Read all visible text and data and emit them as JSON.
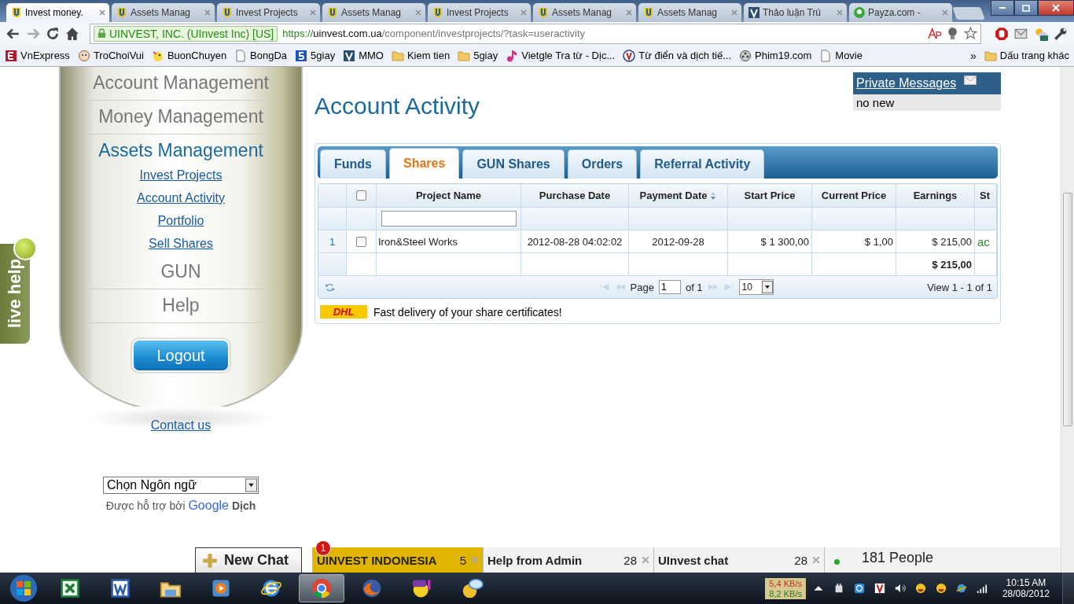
{
  "browser": {
    "tabs": [
      {
        "kind": "shield",
        "title": "Invest money.",
        "selected": true
      },
      {
        "kind": "shield",
        "title": "Assets Manag",
        "selected": false
      },
      {
        "kind": "shield",
        "title": "Invest Projects",
        "selected": false
      },
      {
        "kind": "shield",
        "title": "Assets Manag",
        "selected": false
      },
      {
        "kind": "shield",
        "title": "Invest Projects",
        "selected": false
      },
      {
        "kind": "shield",
        "title": "Assets Manag",
        "selected": false
      },
      {
        "kind": "shield",
        "title": "Assets Manag",
        "selected": false
      },
      {
        "kind": "vsquare",
        "title": "Thảo luận Trú",
        "selected": false
      },
      {
        "kind": "payza",
        "title": "Payza.com -",
        "selected": false
      }
    ],
    "address": {
      "identity": "UINVEST, INC. (UInvest Inc) [US]",
      "scheme": "https://",
      "host": "uinvest.com.ua",
      "path": "/component/investprojects/?task=useractivity"
    },
    "bookmarks": [
      {
        "kind": "ered",
        "label": "VnExpress"
      },
      {
        "kind": "face",
        "label": "TroChoiVui"
      },
      {
        "kind": "chick",
        "label": "BuonChuyen"
      },
      {
        "kind": "page",
        "label": "BongDa"
      },
      {
        "kind": "five",
        "label": "5giay"
      },
      {
        "kind": "vsquare",
        "label": "MMO"
      },
      {
        "kind": "folder",
        "label": "Kiem tien"
      },
      {
        "kind": "folder",
        "label": "5giay"
      },
      {
        "kind": "note",
        "label": "Vietgle Tra từ - Dịc..."
      },
      {
        "kind": "vcircle",
        "label": "Từ điển và dịch tiế..."
      },
      {
        "kind": "reel",
        "label": "Phim19.com"
      },
      {
        "kind": "page",
        "label": "Movie"
      }
    ],
    "overflow": "»",
    "other_bookmarks": "Dấu trang khác"
  },
  "sidebar": {
    "menu": [
      {
        "label": "Account Management",
        "selected": false
      },
      {
        "label": "Money Management",
        "selected": false
      },
      {
        "label": "Assets Management",
        "selected": true,
        "children": [
          {
            "label": "Invest Projects"
          },
          {
            "label": "Account Activity"
          },
          {
            "label": "Portfolio"
          },
          {
            "label": "Sell Shares"
          }
        ]
      },
      {
        "label": "GUN",
        "selected": false
      },
      {
        "label": "Help",
        "selected": false
      }
    ],
    "logout": "Logout",
    "contact": "Contact us",
    "language": {
      "value": "Chọn Ngôn ngữ"
    },
    "powered_by": {
      "text": "Được hỗ trợ bởi",
      "brand": "Google",
      "service": "Dịch"
    }
  },
  "live_help": "live help",
  "heading": "Account Activity",
  "messages": {
    "title": "Private Messages",
    "status": "no new"
  },
  "tabs": [
    {
      "label": "Funds",
      "selected": false
    },
    {
      "label": "Shares",
      "selected": true
    },
    {
      "label": "GUN Shares",
      "selected": false
    },
    {
      "label": "Orders",
      "selected": false
    },
    {
      "label": "Referral Activity",
      "selected": false
    }
  ],
  "table": {
    "select_all": {
      "checked": false
    },
    "columns": [
      {
        "label": "Project Name",
        "sorted": false,
        "filter": true
      },
      {
        "label": "Purchase Date",
        "sorted": false,
        "filter": false
      },
      {
        "label": "Payment Date",
        "sorted": true,
        "filter": false
      },
      {
        "label": "Start Price",
        "sorted": false,
        "filter": false
      },
      {
        "label": "Current Price",
        "sorted": false,
        "filter": false
      },
      {
        "label": "Earnings",
        "sorted": false,
        "filter": false
      },
      {
        "label": "St",
        "sorted": false,
        "filter": false
      }
    ],
    "rows": [
      {
        "number": "1",
        "checked": false,
        "cells": [
          "Iron&Steel Works",
          "2012-08-28 04:02:02",
          "2012-09-28",
          "$ 1 300,00",
          "$ 1,00",
          "$ 215,00",
          "ac"
        ]
      }
    ],
    "total": "$ 215,00",
    "pager": {
      "page_label": "Page",
      "page": "1",
      "of": "of 1",
      "page_size": "10",
      "view": "View 1 - 1 of 1"
    }
  },
  "promo": {
    "logo": "DHL",
    "text": "Fast delivery of your share certificates!"
  },
  "chat": {
    "new_chat": "New Chat",
    "rooms": [
      {
        "name": "UINVEST INDONESIA",
        "count": "5",
        "badge": "1",
        "selected": true
      },
      {
        "name": "Help from Admin",
        "count": "28",
        "selected": false
      },
      {
        "name": "UInvest chat",
        "count": "28",
        "selected": false
      }
    ],
    "online": "181 People"
  },
  "taskbar": {
    "apps": [
      {
        "kind": "excel",
        "selected": false
      },
      {
        "kind": "word",
        "selected": false
      },
      {
        "kind": "explorer",
        "selected": false
      },
      {
        "kind": "media",
        "selected": false
      },
      {
        "kind": "ie",
        "selected": false
      },
      {
        "kind": "chrome",
        "selected": true
      },
      {
        "kind": "firefox",
        "selected": false
      },
      {
        "kind": "yahoo",
        "selected": false
      },
      {
        "kind": "chatapp",
        "selected": false
      }
    ],
    "net": {
      "down": "5,4 KB/s",
      "up": "8,2 KB/s"
    },
    "clock": {
      "time": "10:15 AM",
      "date": "28/08/2012"
    }
  }
}
